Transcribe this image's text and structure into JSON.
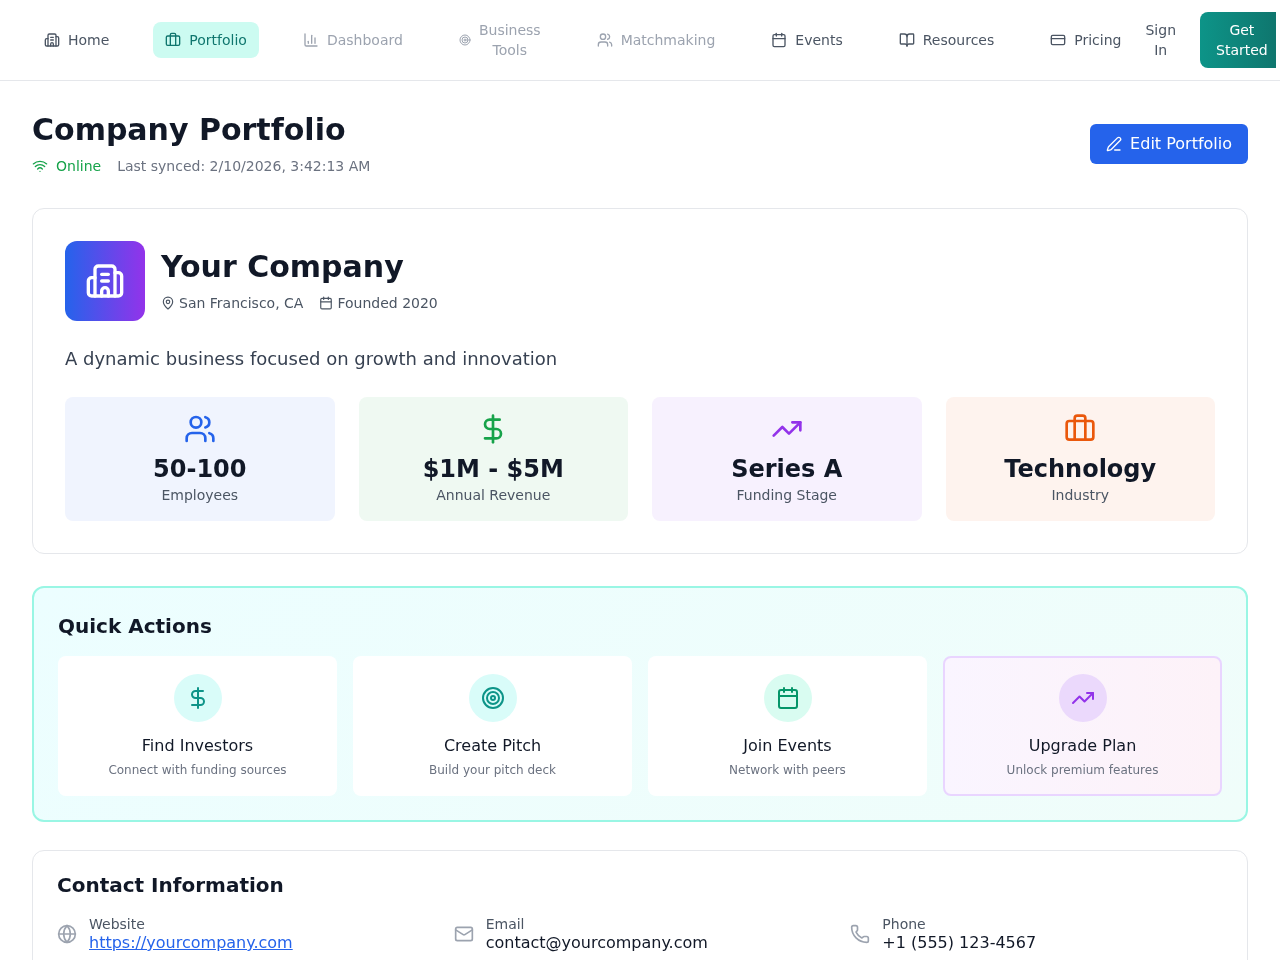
{
  "nav": {
    "items": [
      {
        "label": "Home",
        "selected": false,
        "disabled": false
      },
      {
        "label": "Portfolio",
        "selected": true,
        "disabled": false
      },
      {
        "label": "Dashboard",
        "selected": false,
        "disabled": true
      },
      {
        "label": "Business Tools",
        "selected": false,
        "disabled": true
      },
      {
        "label": "Matchmaking",
        "selected": false,
        "disabled": true
      },
      {
        "label": "Events",
        "selected": false,
        "disabled": false
      },
      {
        "label": "Resources",
        "selected": false,
        "disabled": false
      },
      {
        "label": "Pricing",
        "selected": false,
        "disabled": false
      }
    ],
    "sign_in": "Sign In",
    "cta": "Get Started"
  },
  "header": {
    "title": "Company Portfolio",
    "status": "Online",
    "last_synced": "Last synced: 2/10/2026, 3:42:13 AM",
    "edit_button": "Edit Portfolio"
  },
  "company": {
    "name": "Your Company",
    "location": "San Francisco, CA",
    "founded": "Founded 2020",
    "description": "A dynamic business focused on growth and innovation",
    "stats": [
      {
        "value": "50-100",
        "label": "Employees",
        "color": "#2563eb"
      },
      {
        "value": "$1M - $5M",
        "label": "Annual Revenue",
        "color": "#16a34a"
      },
      {
        "value": "Series A",
        "label": "Funding Stage",
        "color": "#9333ea"
      },
      {
        "value": "Technology",
        "label": "Industry",
        "color": "#ea580c"
      }
    ]
  },
  "quick_actions": {
    "title": "Quick Actions",
    "items": [
      {
        "kind": "standard",
        "title": "Find Investors",
        "description": "Connect with funding sources",
        "color": "#0d9488"
      },
      {
        "kind": "standard",
        "title": "Create Pitch",
        "description": "Build your pitch deck",
        "color": "#0d9488"
      },
      {
        "kind": "standard",
        "title": "Join Events",
        "description": "Network with peers",
        "color": "#059669"
      },
      {
        "kind": "premium",
        "title": "Upgrade Plan",
        "description": "Unlock premium features",
        "color": "#9333ea"
      }
    ]
  },
  "contact": {
    "title": "Contact Information",
    "fields": [
      {
        "kind": "link",
        "label": "Website",
        "value": "https://yourcompany.com"
      },
      {
        "kind": "text",
        "label": "Email",
        "value": "contact@yourcompany.com"
      },
      {
        "kind": "text",
        "label": "Phone",
        "value": "+1 (555) 123-4567"
      }
    ]
  }
}
